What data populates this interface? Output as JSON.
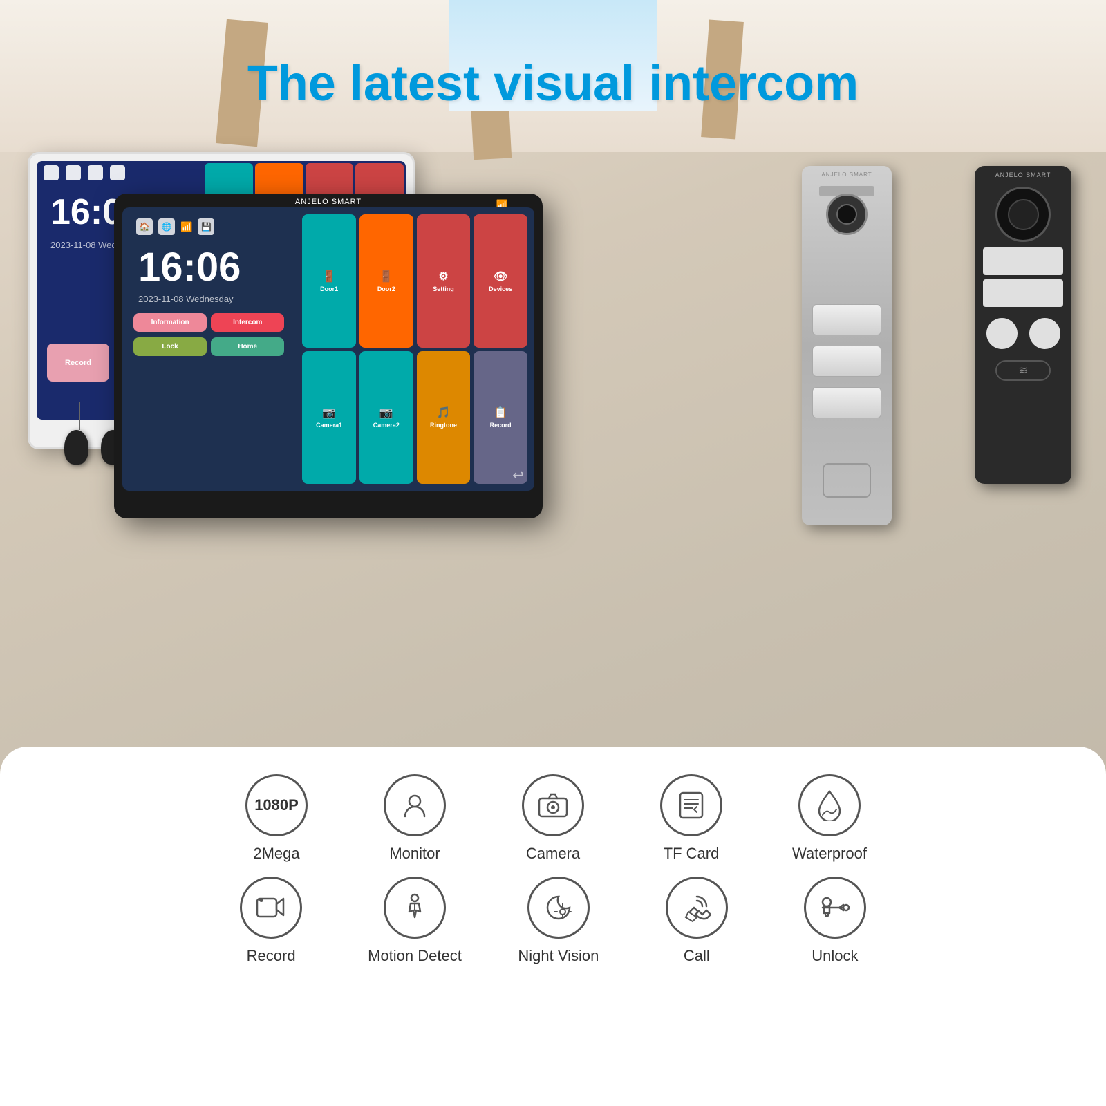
{
  "title": "The latest visual intercom",
  "brand": "ANJELO SMART",
  "monitor_time": "16:06",
  "monitor_date": "2023-11-08 Wednesday",
  "grid_items": [
    {
      "label": "Door1",
      "color": "#00aaaa",
      "icon": "🚪"
    },
    {
      "label": "Door2",
      "color": "#ff6600",
      "icon": "🚪"
    },
    {
      "label": "Setting",
      "color": "#cc4444",
      "icon": "⚙️"
    },
    {
      "label": "Devices",
      "color": "#cc4444",
      "icon": "👁"
    },
    {
      "label": "Camera1",
      "color": "#00aaaa",
      "icon": "📷"
    },
    {
      "label": "Camera2",
      "color": "#00aaaa",
      "icon": "📷"
    },
    {
      "label": "Ringtone",
      "color": "#dd8800",
      "icon": "🎵"
    },
    {
      "label": "Record",
      "color": "#666688",
      "icon": "📋"
    },
    {
      "label": "Information",
      "color": "#ee8899",
      "icon": "✉️"
    },
    {
      "label": "Intercom",
      "color": "#ee4455",
      "icon": "📞"
    },
    {
      "label": "Lock",
      "color": "#88aa44",
      "icon": "🔒"
    },
    {
      "label": "Home",
      "color": "#44aa88",
      "icon": "🏠"
    }
  ],
  "features_row1": [
    {
      "icon": "1080P",
      "label": "2Mega",
      "type": "text"
    },
    {
      "icon": "👤",
      "label": "Monitor",
      "type": "emoji"
    },
    {
      "icon": "📷",
      "label": "Camera",
      "type": "emoji"
    },
    {
      "icon": "💳",
      "label": "TF Card",
      "type": "emoji"
    },
    {
      "icon": "☂️",
      "label": "Waterproof",
      "type": "emoji"
    }
  ],
  "features_row2": [
    {
      "icon": "🎥",
      "label": "Record",
      "type": "emoji"
    },
    {
      "icon": "🚶",
      "label": "Motion Detect",
      "type": "emoji"
    },
    {
      "icon": "🌙",
      "label": "Night Vision",
      "type": "emoji"
    },
    {
      "icon": "🔔",
      "label": "Call",
      "type": "emoji"
    },
    {
      "icon": "🔑",
      "label": "Unlock",
      "type": "emoji"
    }
  ]
}
